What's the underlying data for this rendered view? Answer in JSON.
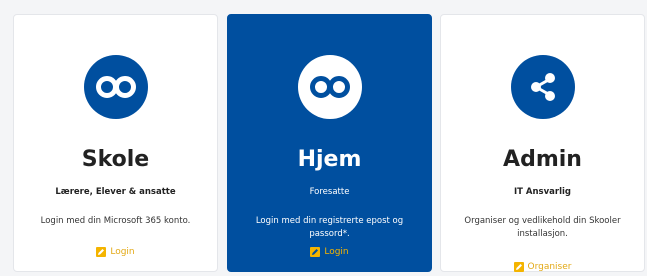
{
  "cards": [
    {
      "title": "Skole",
      "subtitle": "Lærere, Elever & ansatte",
      "description": "Login med din Microsoft 365 konto.",
      "link_label": "Login",
      "icon": "infinity-logo-icon"
    },
    {
      "title": "Hjem",
      "subtitle": "Foresatte",
      "description": "Login med din registrerte epost og passord*.",
      "link_label": "Login",
      "icon": "infinity-logo-icon",
      "active": true
    },
    {
      "title": "Admin",
      "subtitle": "IT Ansvarlig",
      "description": "Organiser og vedlikehold din Skooler installasjon.",
      "link_label": "Organiser",
      "icon": "share-icon"
    }
  ],
  "colors": {
    "brand_blue": "#004f9f",
    "link_yellow": "#f4b400",
    "card_bg": "#ffffff"
  }
}
